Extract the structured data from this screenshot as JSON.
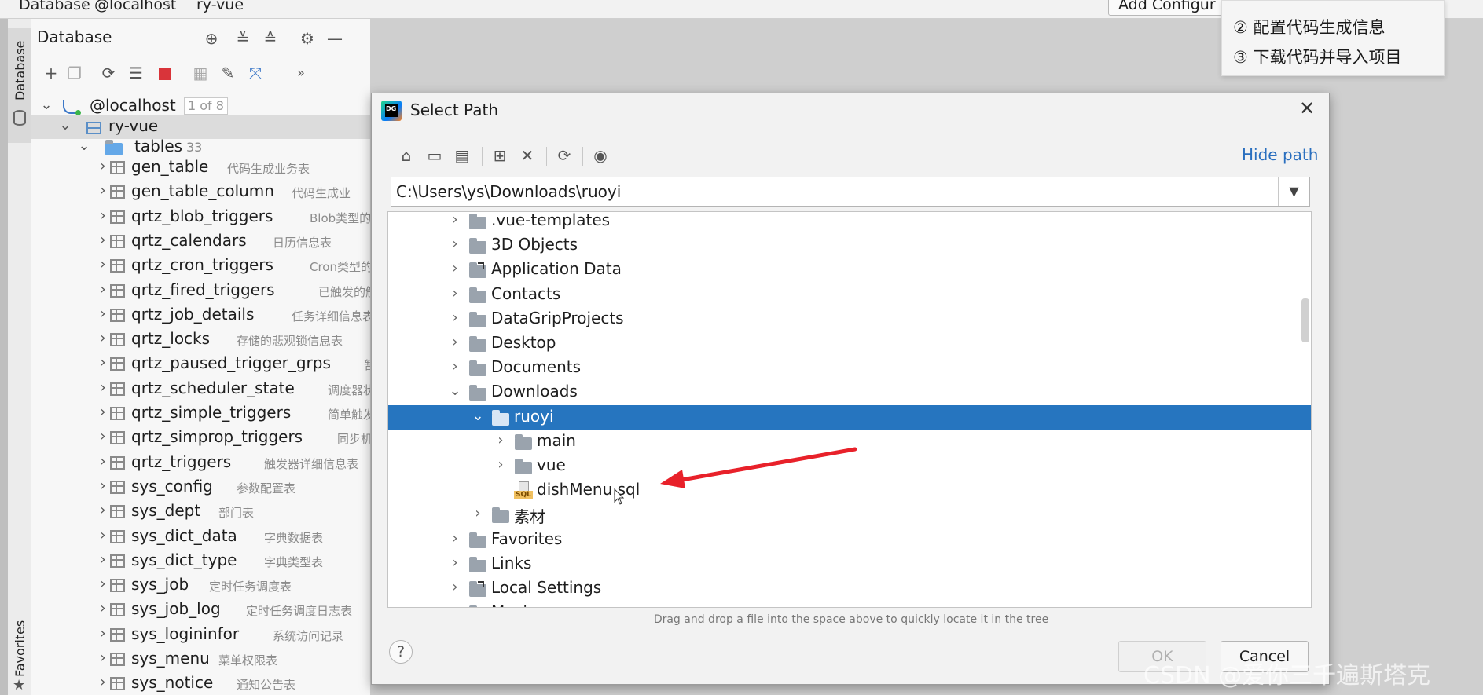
{
  "breadcrumb": {
    "items": [
      "Database",
      "@localhost",
      "ry-vue"
    ],
    "add_config_label": "Add Configur"
  },
  "steps_popup": {
    "step2": "②  配置代码生成信息",
    "step3": "③  下载代码并导入项目"
  },
  "side_strip": {
    "database_tab": "Database",
    "favorites_tab": "Favorites"
  },
  "db_panel": {
    "title": "Database",
    "host_label": "@localhost",
    "host_count": "1 of 8",
    "schema_label": "ry-vue",
    "tables_label": "tables",
    "tables_count": "33",
    "tables": [
      {
        "name": "gen_table",
        "comment": "代码生成业务表"
      },
      {
        "name": "gen_table_column",
        "comment": "代码生成业"
      },
      {
        "name": "qrtz_blob_triggers",
        "comment": "Blob类型的"
      },
      {
        "name": "qrtz_calendars",
        "comment": "日历信息表"
      },
      {
        "name": "qrtz_cron_triggers",
        "comment": "Cron类型的"
      },
      {
        "name": "qrtz_fired_triggers",
        "comment": "已触发的触"
      },
      {
        "name": "qrtz_job_details",
        "comment": "任务详细信息表"
      },
      {
        "name": "qrtz_locks",
        "comment": "存储的悲观锁信息表"
      },
      {
        "name": "qrtz_paused_trigger_grps",
        "comment": "暂"
      },
      {
        "name": "qrtz_scheduler_state",
        "comment": "调度器状"
      },
      {
        "name": "qrtz_simple_triggers",
        "comment": "简单触发"
      },
      {
        "name": "qrtz_simprop_triggers",
        "comment": "同步机"
      },
      {
        "name": "qrtz_triggers",
        "comment": "触发器详细信息表"
      },
      {
        "name": "sys_config",
        "comment": "参数配置表"
      },
      {
        "name": "sys_dept",
        "comment": "部门表"
      },
      {
        "name": "sys_dict_data",
        "comment": "字典数据表"
      },
      {
        "name": "sys_dict_type",
        "comment": "字典类型表"
      },
      {
        "name": "sys_job",
        "comment": "定时任务调度表"
      },
      {
        "name": "sys_job_log",
        "comment": "定时任务调度日志表"
      },
      {
        "name": "sys_logininfor",
        "comment": "系统访问记录"
      },
      {
        "name": "sys_menu",
        "comment": "菜单权限表"
      },
      {
        "name": "sys_notice",
        "comment": "通知公告表"
      }
    ]
  },
  "dialog": {
    "title": "Select Path",
    "hide_path_label": "Hide path",
    "path_value": "C:\\Users\\ys\\Downloads\\ruoyi",
    "tree": [
      {
        "name": ".vue-templates",
        "level": 0,
        "kind": "folder",
        "expanded": false
      },
      {
        "name": "3D Objects",
        "level": 0,
        "kind": "folder",
        "expanded": false
      },
      {
        "name": "Application Data",
        "level": 0,
        "kind": "link",
        "expanded": false
      },
      {
        "name": "Contacts",
        "level": 0,
        "kind": "folder",
        "expanded": false
      },
      {
        "name": "DataGripProjects",
        "level": 0,
        "kind": "folder",
        "expanded": false
      },
      {
        "name": "Desktop",
        "level": 0,
        "kind": "folder",
        "expanded": false
      },
      {
        "name": "Documents",
        "level": 0,
        "kind": "folder",
        "expanded": false
      },
      {
        "name": "Downloads",
        "level": 0,
        "kind": "folder",
        "expanded": true
      },
      {
        "name": "ruoyi",
        "level": 1,
        "kind": "folder",
        "expanded": true,
        "selected": true
      },
      {
        "name": "main",
        "level": 2,
        "kind": "folder",
        "expanded": false
      },
      {
        "name": "vue",
        "level": 2,
        "kind": "folder",
        "expanded": false
      },
      {
        "name": "dishMenu.sql",
        "level": 2,
        "kind": "sql"
      },
      {
        "name": "素材",
        "level": 1,
        "kind": "folder",
        "expanded": false
      },
      {
        "name": "Favorites",
        "level": 0,
        "kind": "folder",
        "expanded": false
      },
      {
        "name": "Links",
        "level": 0,
        "kind": "folder",
        "expanded": false
      },
      {
        "name": "Local Settings",
        "level": 0,
        "kind": "link",
        "expanded": false
      },
      {
        "name": "Music",
        "level": 0,
        "kind": "folder",
        "expanded": false
      }
    ],
    "sql_badge": "SQL",
    "hint": "Drag and drop a file into the space above to quickly locate it in the tree",
    "ok_label": "OK",
    "cancel_label": "Cancel",
    "logo_text": "DG"
  },
  "watermark": "CSDN @爱你三千遍斯塔克",
  "colors": {
    "selection": "#2675bf",
    "link": "#2a6fbf",
    "arrow": "#e8212a"
  }
}
